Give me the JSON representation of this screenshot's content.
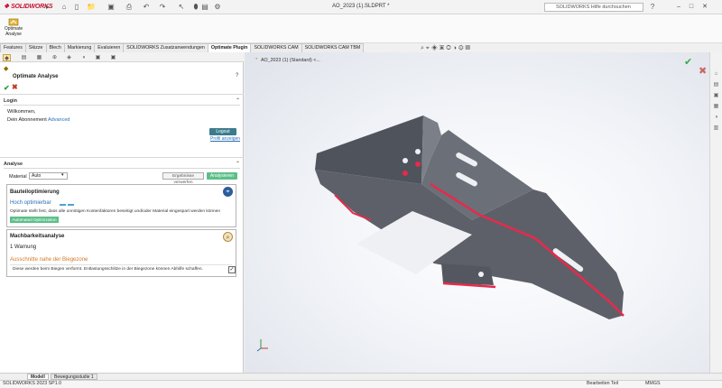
{
  "app": {
    "logo_text": "SOLIDWORKS",
    "document_title": "AO_2023 (1).SLDPRT *",
    "search_placeholder": "SOLIDWORKS Hilfe durchsuchen",
    "ribbon_button": "Optimate\nAnalyse"
  },
  "tabs": [
    {
      "label": "Features"
    },
    {
      "label": "Skizze"
    },
    {
      "label": "Blech"
    },
    {
      "label": "Markierung"
    },
    {
      "label": "Evaluieren"
    },
    {
      "label": "SOLIDWORKS Zusatzanwendungen"
    },
    {
      "label": "Optimate Plugin",
      "active": true
    },
    {
      "label": "SOLIDWORKS CAM"
    },
    {
      "label": "SOLIDWORKS CAM TBM"
    }
  ],
  "panel": {
    "title": "Optimate Analyse",
    "login": {
      "header": "Login",
      "welcome": "Willkommen,",
      "subscription_label": "Dein Abonnement",
      "subscription_value": "Advanced",
      "logout_label": "Logout",
      "profile_link": "Profil anzeigen"
    },
    "analysis": {
      "header": "Analyse",
      "material_label": "Material",
      "material_value": "Auto",
      "results_button": "Ergebnisse verwerfen",
      "analyze_button": "Analysieren",
      "card_part": {
        "title": "Bauteiloptimierung",
        "level": "Hoch optimierbar",
        "description": "Optimate stellt fest, dass alle unnötigen Kostenfaktoren beseitigt und/oder Material eingespart werden können",
        "button": "Automated Optimization"
      },
      "card_mfg": {
        "title": "Machbarkeitsanalyse",
        "warnings": "1 Warnung",
        "item": "Ausschnitte nahe der Biegezone",
        "description": "Diese werden beim Biegen verformt. Entlastungsschlitze in der Biegezone können Abhilfe schaffen."
      }
    }
  },
  "viewport": {
    "tree_label": "AO_2023 (1) (Standard) <..."
  },
  "bottom_tabs": [
    {
      "label": "Modell",
      "active": true
    },
    {
      "label": "Bewegungsstudie 1"
    }
  ],
  "status": {
    "version": "SOLIDWORKS 2023 SP1.0",
    "mode": "Bearbeiten Teil",
    "units": "MMGS"
  },
  "colors": {
    "accent_green": "#5cbf88",
    "logout_blue": "#3b7c8c",
    "link_blue": "#2a6fb8",
    "warning_orange": "#d4782a",
    "highlight_red": "#e8294c",
    "part_gray": "#5d6068"
  }
}
